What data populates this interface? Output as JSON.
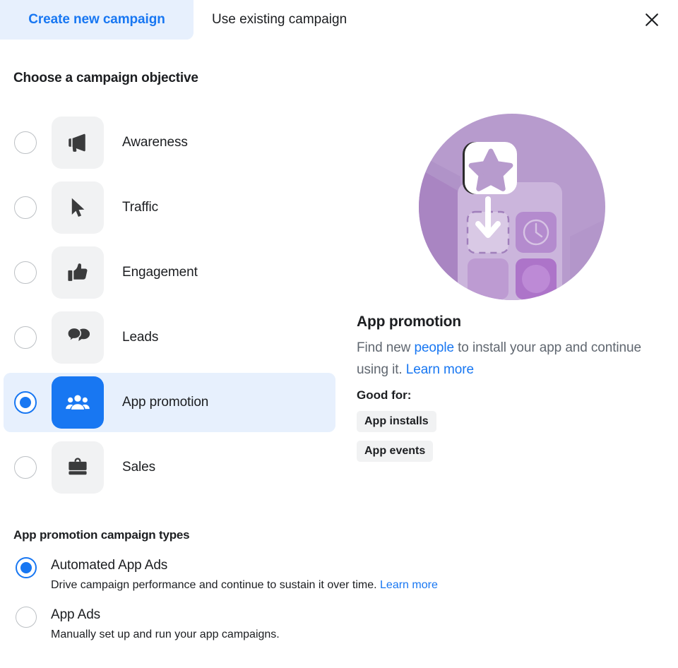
{
  "tabs": {
    "create_new": "Create new campaign",
    "use_existing": "Use existing campaign",
    "close_label": "Close"
  },
  "objective_section": {
    "title": "Choose a campaign objective",
    "items": [
      {
        "label": "Awareness",
        "icon": "megaphone-icon",
        "selected": false
      },
      {
        "label": "Traffic",
        "icon": "cursor-icon",
        "selected": false
      },
      {
        "label": "Engagement",
        "icon": "thumbs-up-icon",
        "selected": false
      },
      {
        "label": "Leads",
        "icon": "speech-bubbles-icon",
        "selected": false
      },
      {
        "label": "App promotion",
        "icon": "people-group-icon",
        "selected": true
      },
      {
        "label": "Sales",
        "icon": "briefcase-icon",
        "selected": false
      }
    ]
  },
  "detail": {
    "illustration": "app-promotion-illustration",
    "title": "App promotion",
    "desc_part1": "Find new ",
    "desc_link1": "people",
    "desc_part2": " to install your app and continue using it. ",
    "desc_link2": "Learn more",
    "good_for_label": "Good for:",
    "tags": [
      "App installs",
      "App events"
    ]
  },
  "campaign_types": {
    "title": "App promotion campaign types",
    "options": [
      {
        "label": "Automated App Ads",
        "sub": "Drive campaign performance and continue to sustain it over time. ",
        "link": "Learn more",
        "selected": true
      },
      {
        "label": "App Ads",
        "sub": "Manually set up and run your app campaigns.",
        "link": "",
        "selected": false
      }
    ]
  },
  "colors": {
    "accent_blue": "#1877f2",
    "tab_active_bg": "#e7f0fd",
    "tile_bg": "#f1f2f3",
    "text_primary": "#1c1e21",
    "text_secondary": "#606770",
    "illustration_purple": "#b79bcd"
  }
}
